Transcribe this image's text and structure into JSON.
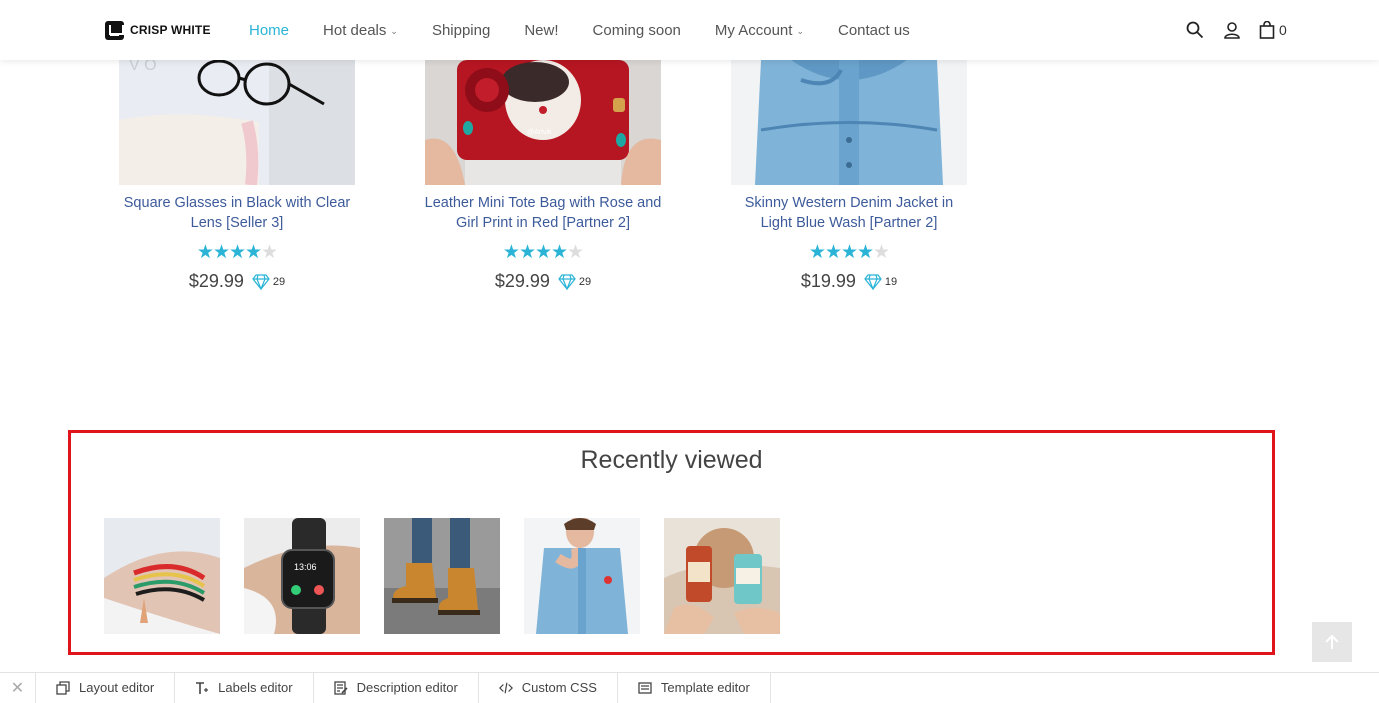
{
  "brand": {
    "name": "CRISP WHITE"
  },
  "nav": [
    {
      "label": "Home",
      "active": true,
      "dropdown": false
    },
    {
      "label": "Hot deals",
      "active": false,
      "dropdown": true
    },
    {
      "label": "Shipping",
      "active": false,
      "dropdown": false
    },
    {
      "label": "New!",
      "active": false,
      "dropdown": false
    },
    {
      "label": "Coming soon",
      "active": false,
      "dropdown": false
    },
    {
      "label": "My Account",
      "active": false,
      "dropdown": true
    },
    {
      "label": "Contact us",
      "active": false,
      "dropdown": false
    }
  ],
  "header_icons": {
    "search": "search-icon",
    "account": "user-icon",
    "cart": "shopping-bag-icon"
  },
  "cart": {
    "count": "0"
  },
  "accent_color": "#2bb4d6",
  "products": [
    {
      "title": "Square Glasses in Black with Clear Lens [Seller 3]",
      "rating": 4,
      "rating_max": 5,
      "price": "$29.99",
      "points": "29"
    },
    {
      "title": "Leather Mini Tote Bag with Rose and Girl Print in Red [Partner 2]",
      "rating": 4,
      "rating_max": 5,
      "price": "$29.99",
      "points": "29"
    },
    {
      "title": "Skinny Western Denim Jacket in Light Blue Wash [Partner 2]",
      "rating": 4,
      "rating_max": 5,
      "price": "$19.99",
      "points": "19"
    }
  ],
  "recently_viewed": {
    "title": "Recently viewed",
    "items": [
      "bracelet",
      "smart-watch",
      "boots",
      "denim-jacket",
      "bottles"
    ]
  },
  "toolbar": [
    {
      "label": "Layout editor",
      "icon": "layout-icon"
    },
    {
      "label": "Labels editor",
      "icon": "text-icon"
    },
    {
      "label": "Description editor",
      "icon": "description-icon"
    },
    {
      "label": "Custom CSS",
      "icon": "code-icon"
    },
    {
      "label": "Template editor",
      "icon": "template-icon"
    }
  ],
  "highlight_color": "#e0141b"
}
